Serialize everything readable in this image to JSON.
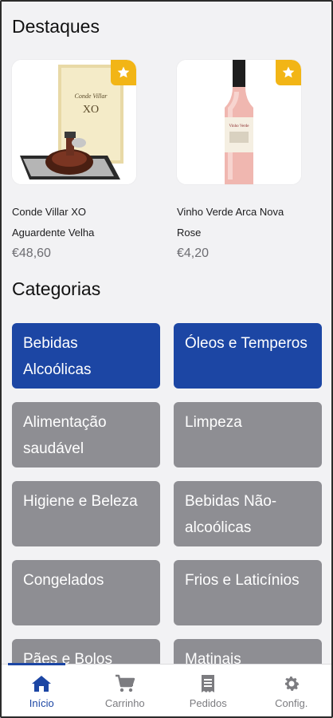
{
  "sections": {
    "featured_title": "Destaques",
    "categories_title": "Categorias"
  },
  "featured": [
    {
      "name": "Conde Villar XO Aguardente Velha",
      "price": "€48,60",
      "icon": "star-icon"
    },
    {
      "name": "Vinho Verde Arca Nova Rose",
      "price": "€4,20",
      "icon": "star-icon"
    }
  ],
  "product_images": {
    "box_text_1": "Conde Villar",
    "box_text_2": "XO",
    "bottle_label": "Vinho Verde"
  },
  "categories": [
    {
      "label": "Bebidas Alcoólicas",
      "active": true
    },
    {
      "label": "Óleos e Temperos",
      "active": true
    },
    {
      "label": "Alimentação saudável",
      "active": false
    },
    {
      "label": "Limpeza",
      "active": false
    },
    {
      "label": "Higiene e Beleza",
      "active": false
    },
    {
      "label": "Bebidas Não-alcoólicas",
      "active": false
    },
    {
      "label": "Congelados",
      "active": false
    },
    {
      "label": "Frios e Laticínios",
      "active": false
    },
    {
      "label": "Pães e Bolos",
      "active": false
    },
    {
      "label": "Matinais",
      "active": false
    }
  ],
  "tabbar": [
    {
      "label": "Início",
      "icon": "home-icon",
      "active": true
    },
    {
      "label": "Carrinho",
      "icon": "cart-icon",
      "active": false
    },
    {
      "label": "Pedidos",
      "icon": "receipt-icon",
      "active": false
    },
    {
      "label": "Config.",
      "icon": "gear-icon",
      "active": false
    }
  ],
  "colors": {
    "accent": "#1c46a4",
    "inactive_category": "#8e8e93",
    "star_badge": "#f2b516",
    "background": "#f2f2f4"
  }
}
